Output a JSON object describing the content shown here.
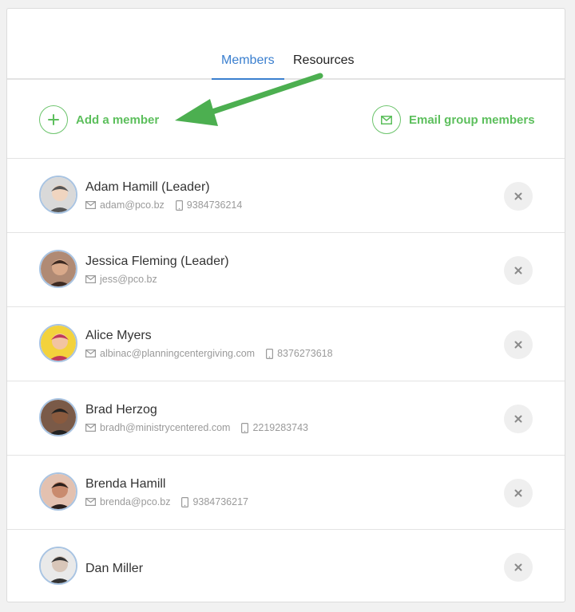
{
  "tabs": {
    "members": "Members",
    "resources": "Resources"
  },
  "actions": {
    "add_member": "Add a member",
    "email_group": "Email group members"
  },
  "colors": {
    "accent_blue": "#3a7fcf",
    "accent_green": "#5cbf5c",
    "arrow_green": "#4caf50"
  },
  "members": [
    {
      "name": "Adam Hamill (Leader)",
      "email": "adam@pco.bz",
      "phone": "9384736214"
    },
    {
      "name": "Jessica Fleming (Leader)",
      "email": "jess@pco.bz",
      "phone": ""
    },
    {
      "name": "Alice Myers",
      "email": "albinac@planningcentergiving.com",
      "phone": "8376273618"
    },
    {
      "name": "Brad Herzog",
      "email": "bradh@ministrycentered.com",
      "phone": "2219283743"
    },
    {
      "name": "Brenda Hamill",
      "email": "brenda@pco.bz",
      "phone": "9384736217"
    },
    {
      "name": "Dan Miller",
      "email": "",
      "phone": ""
    }
  ]
}
